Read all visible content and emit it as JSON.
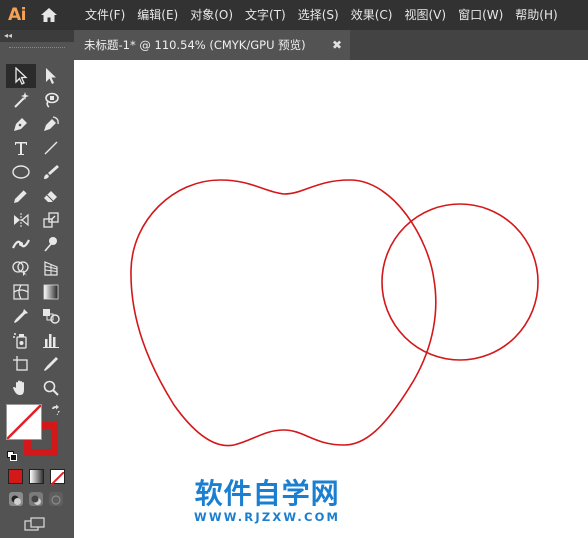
{
  "app": {
    "logo": "Ai"
  },
  "menu": [
    {
      "label": "文件(F)"
    },
    {
      "label": "编辑(E)"
    },
    {
      "label": "对象(O)"
    },
    {
      "label": "文字(T)"
    },
    {
      "label": "选择(S)"
    },
    {
      "label": "效果(C)"
    },
    {
      "label": "视图(V)"
    },
    {
      "label": "窗口(W)"
    },
    {
      "label": "帮助(H)"
    }
  ],
  "document_tab": {
    "title": "未标题-1* @ 110.54% (CMYK/GPU 预览)",
    "close_glyph": "✖"
  },
  "toolbar": {
    "collapse_glyph": "◂◂",
    "tools": [
      [
        "selection-tool",
        "direct-selection-tool"
      ],
      [
        "magic-wand-tool",
        "lasso-tool"
      ],
      [
        "pen-tool",
        "curvature-tool"
      ],
      [
        "type-tool",
        "line-segment-tool"
      ],
      [
        "ellipse-tool",
        "paintbrush-tool"
      ],
      [
        "shaper-tool",
        "eraser-tool"
      ],
      [
        "rotate-tool",
        "scale-tool"
      ],
      [
        "width-tool",
        "puppet-warp-tool"
      ],
      [
        "shape-builder-tool",
        "perspective-grid-tool"
      ],
      [
        "mesh-tool",
        "gradient-tool"
      ],
      [
        "eyedropper-tool",
        "blend-tool"
      ],
      [
        "symbol-sprayer-tool",
        "column-graph-tool"
      ],
      [
        "artboard-tool",
        "slice-tool"
      ],
      [
        "hand-tool",
        "zoom-tool"
      ]
    ]
  },
  "colors": {
    "fill": "none",
    "stroke": "#d3181a",
    "canvas_bg": "#ffffff",
    "ui_bg": "#535353",
    "menu_bg": "#323232"
  },
  "watermark": {
    "title": "软件自学网",
    "url": "WWW.RJZXW.COM"
  }
}
